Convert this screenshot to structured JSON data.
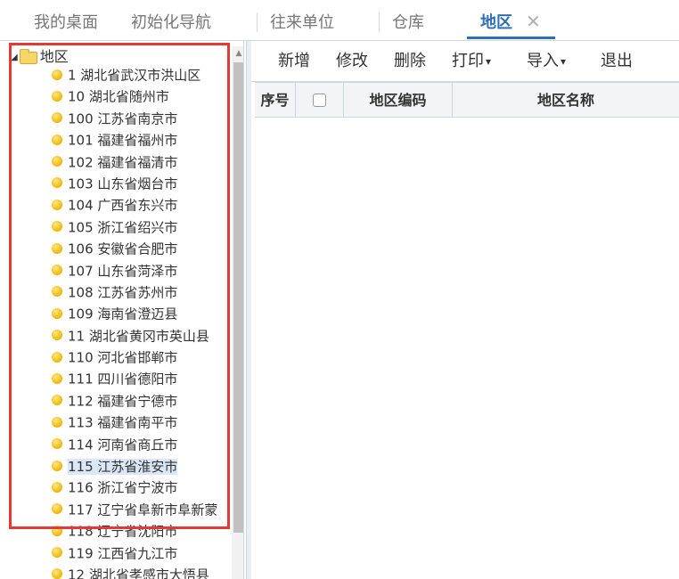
{
  "tabs": [
    {
      "label": "我的桌面"
    },
    {
      "label": "初始化导航"
    },
    {
      "label": "往来单位"
    },
    {
      "label": "仓库"
    },
    {
      "label": "地区"
    }
  ],
  "tab_close_glyph": "✕",
  "tree": {
    "root_label": "地区",
    "items": [
      {
        "label": "1 湖北省武汉市洪山区"
      },
      {
        "label": "10 湖北省随州市"
      },
      {
        "label": "100 江苏省南京市"
      },
      {
        "label": "101 福建省福州市"
      },
      {
        "label": "102 福建省福清市"
      },
      {
        "label": "103 山东省烟台市"
      },
      {
        "label": "104 广西省东兴市"
      },
      {
        "label": "105 浙江省绍兴市"
      },
      {
        "label": "106 安徽省合肥市"
      },
      {
        "label": "107 山东省菏泽市"
      },
      {
        "label": "108 江苏省苏州市"
      },
      {
        "label": "109 海南省澄迈县"
      },
      {
        "label": "11 湖北省黄冈市英山县"
      },
      {
        "label": "110 河北省邯郸市"
      },
      {
        "label": "111 四川省德阳市"
      },
      {
        "label": "112 福建省宁德市"
      },
      {
        "label": "113 福建省南平市"
      },
      {
        "label": "114 河南省商丘市"
      },
      {
        "label": "115 江苏省淮安市"
      },
      {
        "label": "116 浙江省宁波市"
      },
      {
        "label": "117 辽宁省阜新市阜新蒙"
      },
      {
        "label": "118 辽宁省沈阳市"
      },
      {
        "label": "119 江西省九江市"
      },
      {
        "label": "12 湖北省孝感市大悟县"
      }
    ],
    "selected_index": 18
  },
  "toolbar": {
    "add": "新增",
    "edit": "修改",
    "delete": "删除",
    "print": "打印",
    "import": "导入",
    "exit": "退出",
    "caret": "▾"
  },
  "grid": {
    "columns": [
      "序号",
      "",
      "地区编码",
      "地区名称"
    ]
  },
  "colors": {
    "accent": "#2f6fb5",
    "highlight_box": "#e53935",
    "selected_row": "#dbe7f6"
  }
}
